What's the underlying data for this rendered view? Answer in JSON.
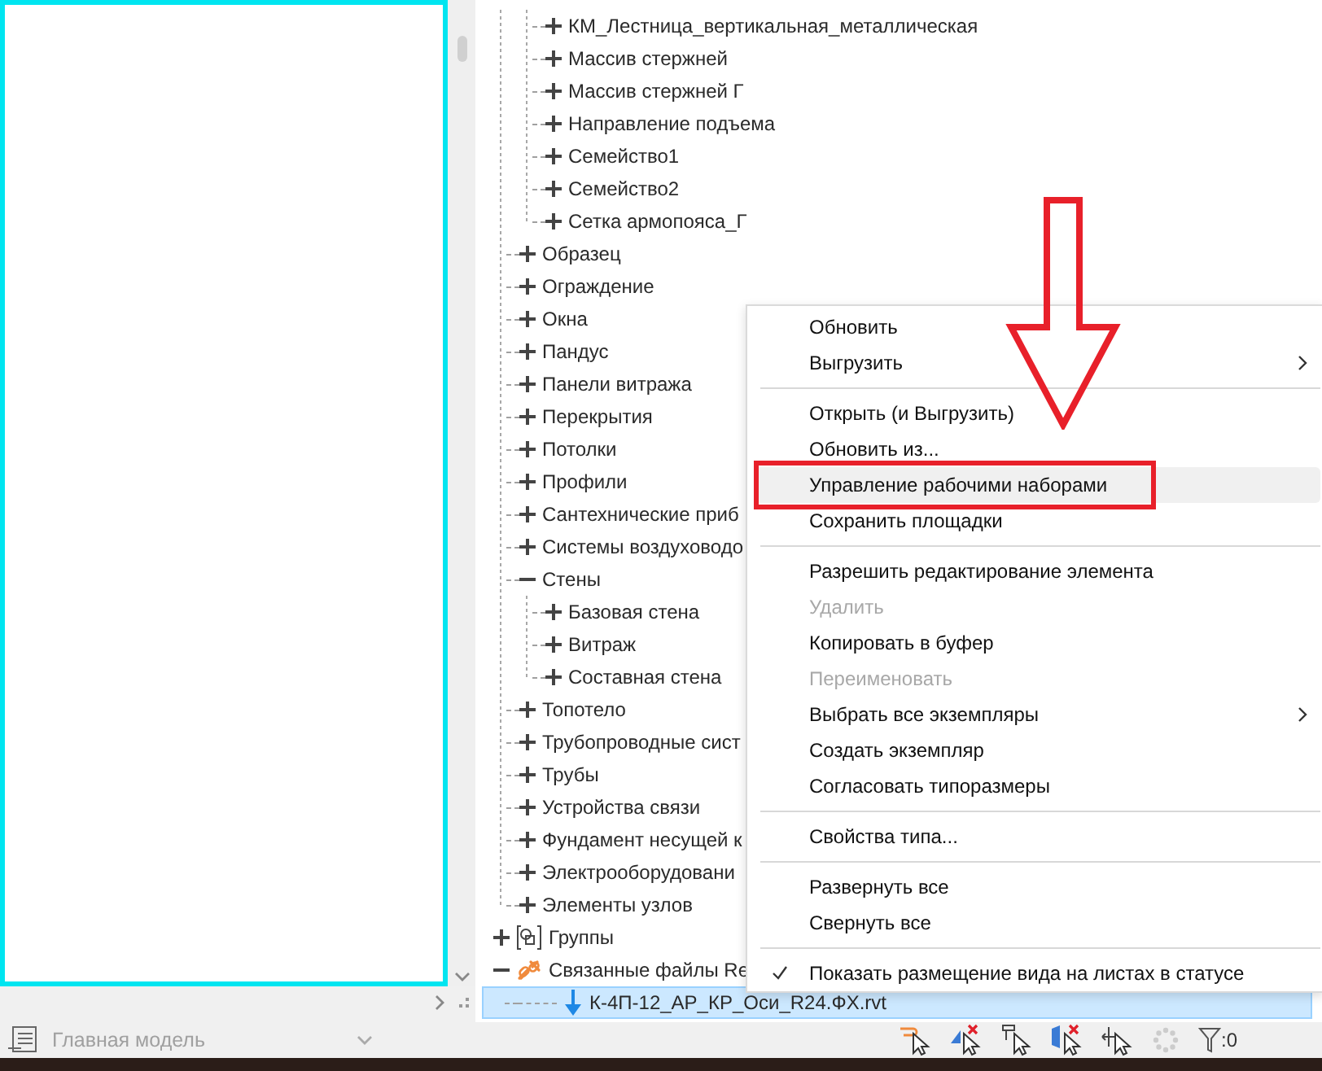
{
  "tree": {
    "items": [
      {
        "children": [
          {
            "children": [
              {
                "label": "КМ_Лестница_вертикальная_металлическая",
                "expanded": false,
                "selected": false,
                "kind": "category"
              },
              {
                "label": "Массив стержней",
                "expanded": false,
                "selected": false,
                "kind": "category"
              },
              {
                "label": "Массив стержней Г",
                "expanded": false,
                "selected": false,
                "kind": "category"
              },
              {
                "label": "Направление подъема",
                "expanded": false,
                "selected": false,
                "kind": "category"
              },
              {
                "label": "Семейство1",
                "expanded": false,
                "selected": false,
                "kind": "category"
              },
              {
                "label": "Семейство2",
                "expanded": false,
                "selected": false,
                "kind": "category"
              },
              {
                "label": "Сетка армопояса_Г",
                "expanded": false,
                "selected": false,
                "kind": "category"
              }
            ]
          },
          {
            "label": "Образец",
            "expanded": false,
            "selected": false,
            "kind": "category"
          },
          {
            "label": "Ограждение",
            "expanded": false,
            "selected": false,
            "kind": "category"
          },
          {
            "label": "Окна",
            "expanded": false,
            "selected": false,
            "kind": "category"
          },
          {
            "label": "Пандус",
            "expanded": false,
            "selected": false,
            "kind": "category"
          },
          {
            "label": "Панели витража",
            "expanded": false,
            "selected": false,
            "kind": "category"
          },
          {
            "label": "Перекрытия",
            "expanded": false,
            "selected": false,
            "kind": "category"
          },
          {
            "label": "Потолки",
            "expanded": false,
            "selected": false,
            "kind": "category"
          },
          {
            "label": "Профили",
            "expanded": false,
            "selected": false,
            "kind": "category"
          },
          {
            "label": "Сантехнические приб",
            "expanded": false,
            "selected": false,
            "kind": "category"
          },
          {
            "label": "Системы воздуховодо",
            "expanded": false,
            "selected": false,
            "kind": "category"
          },
          {
            "label": "Стены",
            "expanded": true,
            "selected": false,
            "kind": "category",
            "children": [
              {
                "label": "Базовая стена",
                "expanded": false,
                "selected": false,
                "kind": "category"
              },
              {
                "label": "Витраж",
                "expanded": false,
                "selected": false,
                "kind": "category"
              },
              {
                "label": "Составная стена",
                "expanded": false,
                "selected": false,
                "kind": "category"
              }
            ]
          },
          {
            "label": "Топотело",
            "expanded": false,
            "selected": false,
            "kind": "category"
          },
          {
            "label": "Трубопроводные сист",
            "expanded": false,
            "selected": false,
            "kind": "category"
          },
          {
            "label": "Трубы",
            "expanded": false,
            "selected": false,
            "kind": "category"
          },
          {
            "label": "Устройства связи",
            "expanded": false,
            "selected": false,
            "kind": "category"
          },
          {
            "label": "Фундамент несущей к",
            "expanded": false,
            "selected": false,
            "kind": "category"
          },
          {
            "label": "Электрооборудовани",
            "expanded": false,
            "selected": false,
            "kind": "category"
          },
          {
            "label": "Элементы узлов",
            "expanded": false,
            "selected": false,
            "kind": "category"
          }
        ]
      },
      {
        "label": "Группы",
        "expanded": false,
        "selected": false,
        "kind": "group"
      },
      {
        "label": "Связанные файлы Re",
        "expanded": true,
        "selected": false,
        "kind": "link",
        "children": [
          {
            "label": "К-4П-12_АР_КР_Оси_R24.ФХ.rvt",
            "selected": true,
            "kind": "file"
          }
        ]
      }
    ]
  },
  "context_menu": {
    "items": [
      {
        "kind": "item",
        "label": "Обновить",
        "disabled": false,
        "submenu": false,
        "checked": false,
        "selected": false
      },
      {
        "kind": "item",
        "label": "Выгрузить",
        "disabled": false,
        "submenu": true,
        "checked": false,
        "selected": false
      },
      {
        "kind": "separator"
      },
      {
        "kind": "item",
        "label": "Открыть (и Выгрузить)",
        "disabled": false,
        "submenu": false,
        "checked": false,
        "selected": false
      },
      {
        "kind": "item",
        "label": "Обновить из...",
        "disabled": false,
        "submenu": false,
        "checked": false,
        "selected": false
      },
      {
        "kind": "item",
        "label": "Управление рабочими наборами",
        "disabled": false,
        "submenu": false,
        "checked": false,
        "selected": true
      },
      {
        "kind": "item",
        "label": "Сохранить площадки",
        "disabled": false,
        "submenu": false,
        "checked": false,
        "selected": false
      },
      {
        "kind": "separator"
      },
      {
        "kind": "item",
        "label": "Разрешить редактирование элемента",
        "disabled": false,
        "submenu": false,
        "checked": false,
        "selected": false
      },
      {
        "kind": "item",
        "label": "Удалить",
        "disabled": true,
        "submenu": false,
        "checked": false,
        "selected": false
      },
      {
        "kind": "item",
        "label": "Копировать в буфер",
        "disabled": false,
        "submenu": false,
        "checked": false,
        "selected": false
      },
      {
        "kind": "item",
        "label": "Переименовать",
        "disabled": true,
        "submenu": false,
        "checked": false,
        "selected": false
      },
      {
        "kind": "item",
        "label": "Выбрать все экземпляры",
        "disabled": false,
        "submenu": true,
        "checked": false,
        "selected": false
      },
      {
        "kind": "item",
        "label": "Создать экземпляр",
        "disabled": false,
        "submenu": false,
        "checked": false,
        "selected": false
      },
      {
        "kind": "item",
        "label": "Согласовать типоразмеры",
        "disabled": false,
        "submenu": false,
        "checked": false,
        "selected": false
      },
      {
        "kind": "separator"
      },
      {
        "kind": "item",
        "label": "Свойства типа...",
        "disabled": false,
        "submenu": false,
        "checked": false,
        "selected": false
      },
      {
        "kind": "separator"
      },
      {
        "kind": "item",
        "label": "Развернуть все",
        "disabled": false,
        "submenu": false,
        "checked": false,
        "selected": false
      },
      {
        "kind": "item",
        "label": "Свернуть все",
        "disabled": false,
        "submenu": false,
        "checked": false,
        "selected": false
      },
      {
        "kind": "separator"
      },
      {
        "kind": "item",
        "label": "Показать размещение вида на листах в статусе",
        "disabled": false,
        "submenu": false,
        "checked": true,
        "selected": false
      }
    ]
  },
  "status_bar": {
    "model_selector": {
      "value": "Главная модель"
    },
    "filter_count": ":0"
  }
}
